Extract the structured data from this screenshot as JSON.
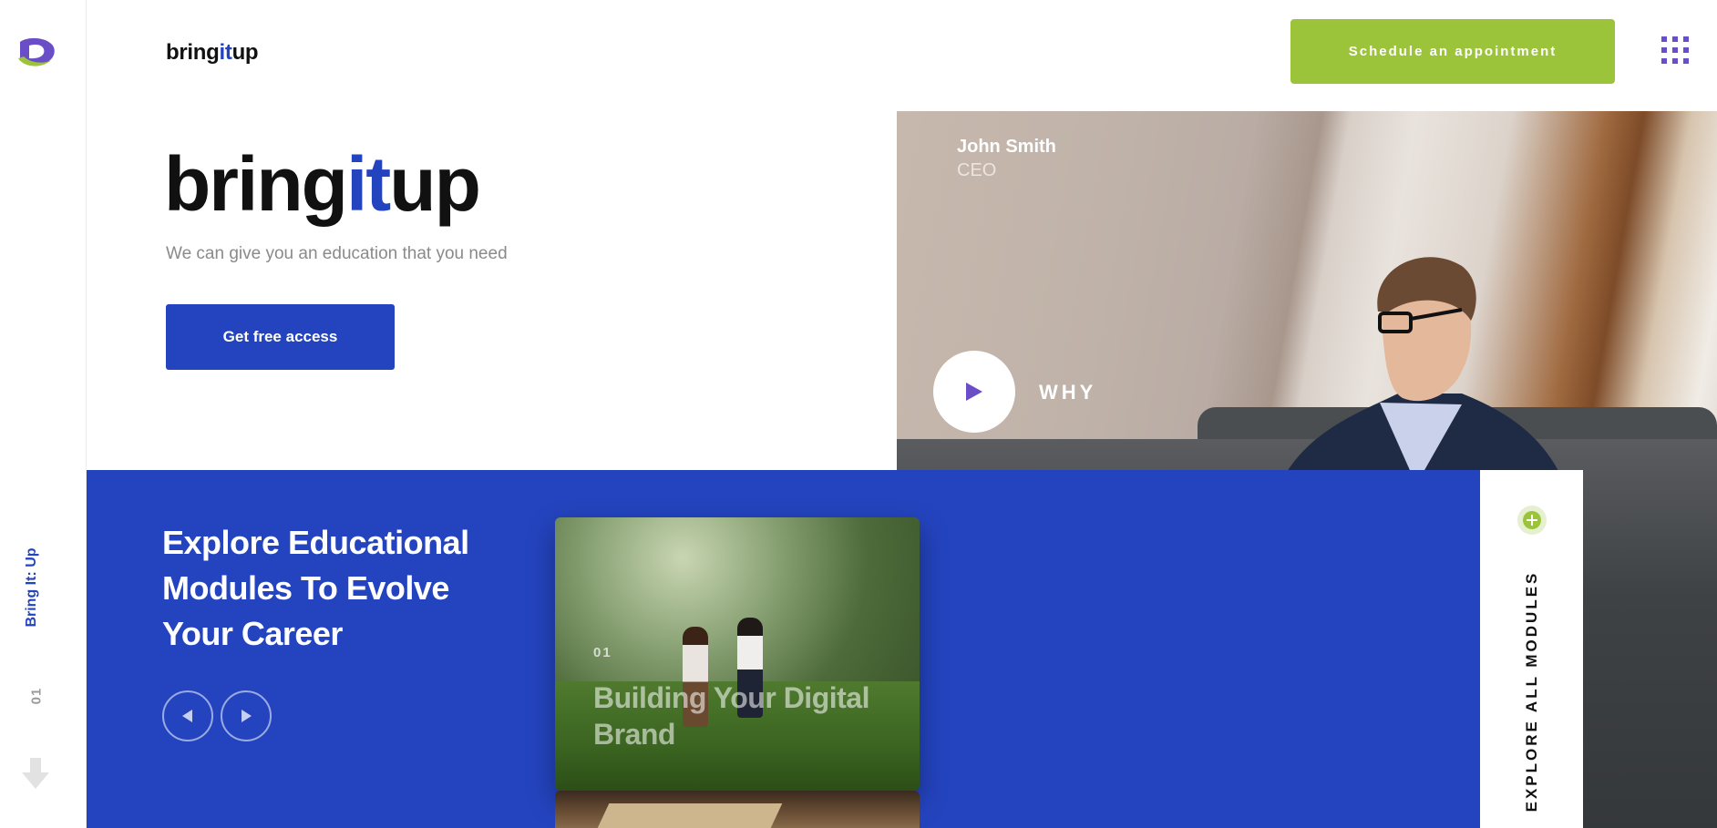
{
  "header": {
    "brand": {
      "part1": "bring",
      "part2": "it",
      "part3": "up"
    },
    "appointment_label": "Schedule an appointment"
  },
  "rail": {
    "vertical_title": "Bring It: Up",
    "slide_number": "01"
  },
  "hero": {
    "brand": {
      "part1": "bring",
      "part2": "it",
      "part3": "up"
    },
    "subtitle": "We can give you an education that you need",
    "cta_label": "Get free access",
    "person_name": "John Smith",
    "person_role": "CEO",
    "video_label": "WHY"
  },
  "modules": {
    "title": "Explore Educational Modules To Evolve Your Career",
    "cards": [
      {
        "number": "01",
        "title": "Building Your Digital Brand"
      }
    ],
    "explore_all_label": "EXPLORE ALL MODULES"
  },
  "colors": {
    "brand_blue": "#2444bf",
    "accent_green": "#9bc43a",
    "menu_purple": "#6a4ec7"
  }
}
